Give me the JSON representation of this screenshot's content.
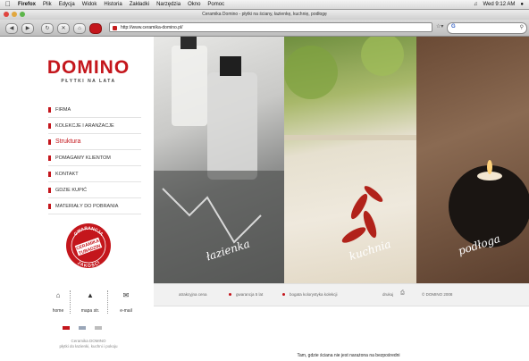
{
  "menubar": {
    "items": [
      "Firefox",
      "Plik",
      "Edycja",
      "Widok",
      "Historia",
      "Zakładki",
      "Narzędzia",
      "Okno",
      "Pomoc"
    ],
    "clock": "Wed 9:12 AM"
  },
  "window": {
    "title": "Ceramika Domino - płytki na ściany, łazienkę, kuchnię, podłogę"
  },
  "toolbar": {
    "url": "http://www.ceramika-domino.pl/"
  },
  "logo": {
    "word": "DOMINO",
    "tagline": "PŁYTKI NA LATA"
  },
  "menu": {
    "items": [
      {
        "label": "FIRMA"
      },
      {
        "label": "KOLEKCJE I ARANŻACJE"
      },
      {
        "label": "Struktura"
      },
      {
        "label": "POMAGAMY KLIENTOM"
      },
      {
        "label": "KONTAKT"
      },
      {
        "label": "GDZIE KUPIĆ"
      },
      {
        "label": "MATERIAŁY DO POBRANIA"
      }
    ]
  },
  "badge": {
    "ring_text": "GWARANCJA",
    "center_line1": "CERAMIKA",
    "center_line2": "TUBĄDZIN",
    "bottom_text": "JAKOŚCI"
  },
  "bottom_nav": {
    "home": "home",
    "sitemap": "mapa str.",
    "email": "e-mail"
  },
  "footer": {
    "line1": "Ceramika DOMINO",
    "line2": "płytki do łazienki, kuchni i pokoju"
  },
  "photos": {
    "p1_caption": "łazienka",
    "p2_caption": "kuchnia",
    "p3_caption": "podłoga"
  },
  "infobar": {
    "item1": "atrakcyjna cena",
    "item2": "gwarancja 5 lat",
    "item3": "bogata kolorystyka kolekcji",
    "print": "drukuj",
    "copyright": "© DOMINO 2008"
  },
  "status": {
    "text": "Tam, gdzie ściana nie jest narażona na bezpośredni"
  },
  "colors": {
    "brand_red": "#c4161c"
  }
}
